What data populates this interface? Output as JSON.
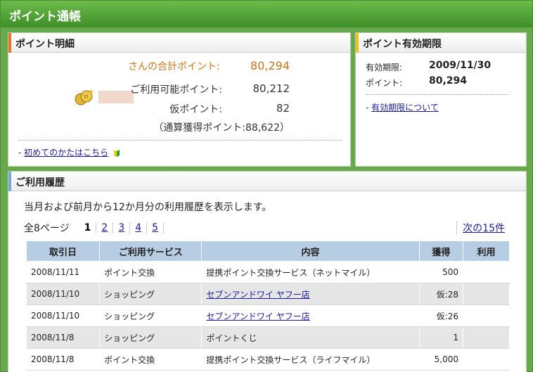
{
  "header": {
    "title": "ポイント通帳"
  },
  "detail": {
    "title": "ポイント明細",
    "total_label": "さんの合計ポイント:",
    "total_value": "80,294",
    "usable_label": "ご利用可能ポイント:",
    "usable_value": "80,212",
    "provisional_label": "仮ポイント:",
    "provisional_value": "82",
    "cumulative": "（通算獲得ポイント:88,622）",
    "first_time_link": "初めてのかたはこちら",
    "dash": "-"
  },
  "expiry": {
    "title": "ポイント有効期限",
    "date_label": "有効期限:",
    "date_value": "2009/11/30",
    "points_label": "ポイント:",
    "points_value": "80,294",
    "about_link": "有効期限について",
    "dash": "-"
  },
  "history": {
    "title": "ご利用履歴",
    "description": "当月および前月から12か月分の利用履歴を表示します。",
    "total_pages": "全8ページ",
    "pages": [
      "1",
      "2",
      "3",
      "4",
      "5"
    ],
    "next": "次の15件",
    "columns": [
      "取引日",
      "ご利用サービス",
      "内容",
      "獲得",
      "利用"
    ],
    "rows": [
      {
        "date": "2008/11/11",
        "service": "ポイント交換",
        "content": "提携ポイント交換サービス（ネットマイル）",
        "earned": "500",
        "used": ""
      },
      {
        "date": "2008/11/10",
        "service": "ショッピング",
        "content": "セブンアンドワイ ヤフー店",
        "earned": "仮:28",
        "used": ""
      },
      {
        "date": "2008/11/10",
        "service": "ショッピング",
        "content": "セブンアンドワイ ヤフー店",
        "earned": "仮:26",
        "used": ""
      },
      {
        "date": "2008/11/8",
        "service": "ショッピング",
        "content": "ポイントくじ",
        "earned": "1",
        "used": ""
      },
      {
        "date": "2008/11/8",
        "service": "ポイント交換",
        "content": "提携ポイント交換サービス（ライフマイル）",
        "earned": "5,000",
        "used": ""
      }
    ]
  },
  "colors": {
    "green": "#4f9a35",
    "orange_accent": "#e8742a",
    "yellow_accent": "#f0c020",
    "blue_accent": "#7aa6d6",
    "header_blue": "#b7cde3"
  }
}
